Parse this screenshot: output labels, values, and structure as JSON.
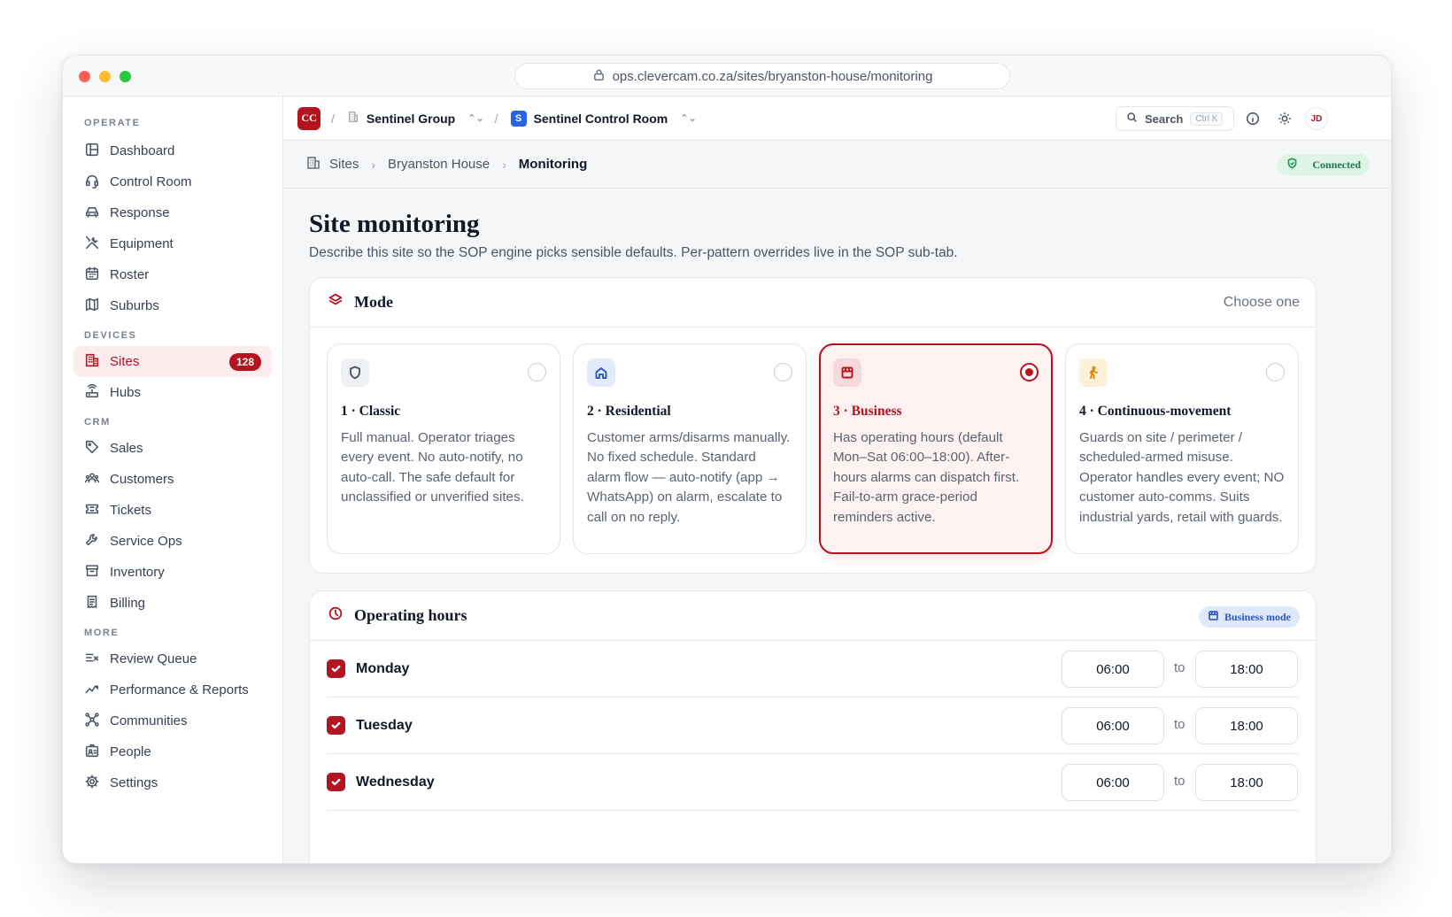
{
  "browser": {
    "url": "ops.clevercam.co.za/sites/bryanston-house/monitoring"
  },
  "sidebar": {
    "sections": [
      {
        "label": "OPERATE",
        "items": [
          {
            "label": "Dashboard",
            "icon": "dashboard-icon"
          },
          {
            "label": "Control Room",
            "icon": "headset-icon"
          },
          {
            "label": "Response",
            "icon": "car-icon"
          },
          {
            "label": "Equipment",
            "icon": "tools-icon"
          },
          {
            "label": "Roster",
            "icon": "calendar-icon"
          },
          {
            "label": "Suburbs",
            "icon": "map-icon"
          }
        ]
      },
      {
        "label": "DEVICES",
        "items": [
          {
            "label": "Sites",
            "icon": "building-icon",
            "badge": "128",
            "active": true
          },
          {
            "label": "Hubs",
            "icon": "router-icon"
          }
        ]
      },
      {
        "label": "CRM",
        "items": [
          {
            "label": "Sales",
            "icon": "tag-icon"
          },
          {
            "label": "Customers",
            "icon": "users-icon"
          },
          {
            "label": "Tickets",
            "icon": "ticket-icon"
          },
          {
            "label": "Service Ops",
            "icon": "wrench-icon"
          },
          {
            "label": "Inventory",
            "icon": "archive-icon"
          },
          {
            "label": "Billing",
            "icon": "receipt-icon"
          }
        ]
      },
      {
        "label": "MORE",
        "items": [
          {
            "label": "Review Queue",
            "icon": "list-check-icon"
          },
          {
            "label": "Performance & Reports",
            "icon": "trend-icon"
          },
          {
            "label": "Communities",
            "icon": "network-icon"
          },
          {
            "label": "People",
            "icon": "id-card-icon"
          },
          {
            "label": "Settings",
            "icon": "gear-icon"
          }
        ]
      }
    ]
  },
  "topbar": {
    "org_logo": "CC",
    "org_name": "Sentinel Group",
    "room_logo": "S",
    "room_name": "Sentinel Control Room",
    "search_label": "Search",
    "search_shortcut": "Ctrl K",
    "avatar": "JD"
  },
  "breadcrumb": {
    "items": [
      "Sites",
      "Bryanston House"
    ],
    "current": "Monitoring",
    "status": "Connected"
  },
  "page": {
    "title": "Site monitoring",
    "subtitle": "Describe this site so the SOP engine picks sensible defaults. Per-pattern overrides live in the SOP sub-tab."
  },
  "mode_card": {
    "title": "Mode",
    "hint": "Choose one",
    "options": [
      {
        "title": "1 · Classic",
        "desc": "Full manual. Operator triages every event. No auto-notify, no auto-call. The safe default for unclassified or unverified sites.",
        "icon": "shield-icon",
        "selected": false,
        "icon_bg": "#eef0f3",
        "icon_color": "#4b5563"
      },
      {
        "title": "2 · Residential",
        "desc": "Customer arms/disarms manually. No fixed schedule. Standard alarm flow — auto-notify (app → WhatsApp) on alarm, escalate to call on no reply.",
        "icon": "home-icon",
        "selected": false,
        "icon_bg": "#e3ebfb",
        "icon_color": "#2b55c4"
      },
      {
        "title": "3 · Business",
        "desc": "Has operating hours (default Mon–Sat 06:00–18:00). After-hours alarms can dispatch first. Fail-to-arm grace-period reminders active.",
        "icon": "store-icon",
        "selected": true,
        "icon_bg": "#f7d9dc",
        "icon_color": "#b4141f"
      },
      {
        "title": "4 · Continuous-movement",
        "desc": "Guards on site / perimeter / scheduled-armed misuse. Operator handles every event; NO customer auto-comms. Suits industrial yards, retail with guards.",
        "icon": "walking-person-icon",
        "selected": false,
        "icon_bg": "#fdf0d8",
        "icon_color": "#d98a06"
      }
    ]
  },
  "hours_card": {
    "title": "Operating hours",
    "badge": "Business mode",
    "to_label": "to",
    "days": [
      {
        "day": "Monday",
        "checked": true,
        "from": "06:00",
        "to": "18:00"
      },
      {
        "day": "Tuesday",
        "checked": true,
        "from": "06:00",
        "to": "18:00"
      },
      {
        "day": "Wednesday",
        "checked": true,
        "from": "06:00",
        "to": "18:00"
      }
    ]
  },
  "colors": {
    "brand": "#b4141f",
    "accent_blue": "#2b55c4",
    "success": "#1e7a44"
  }
}
